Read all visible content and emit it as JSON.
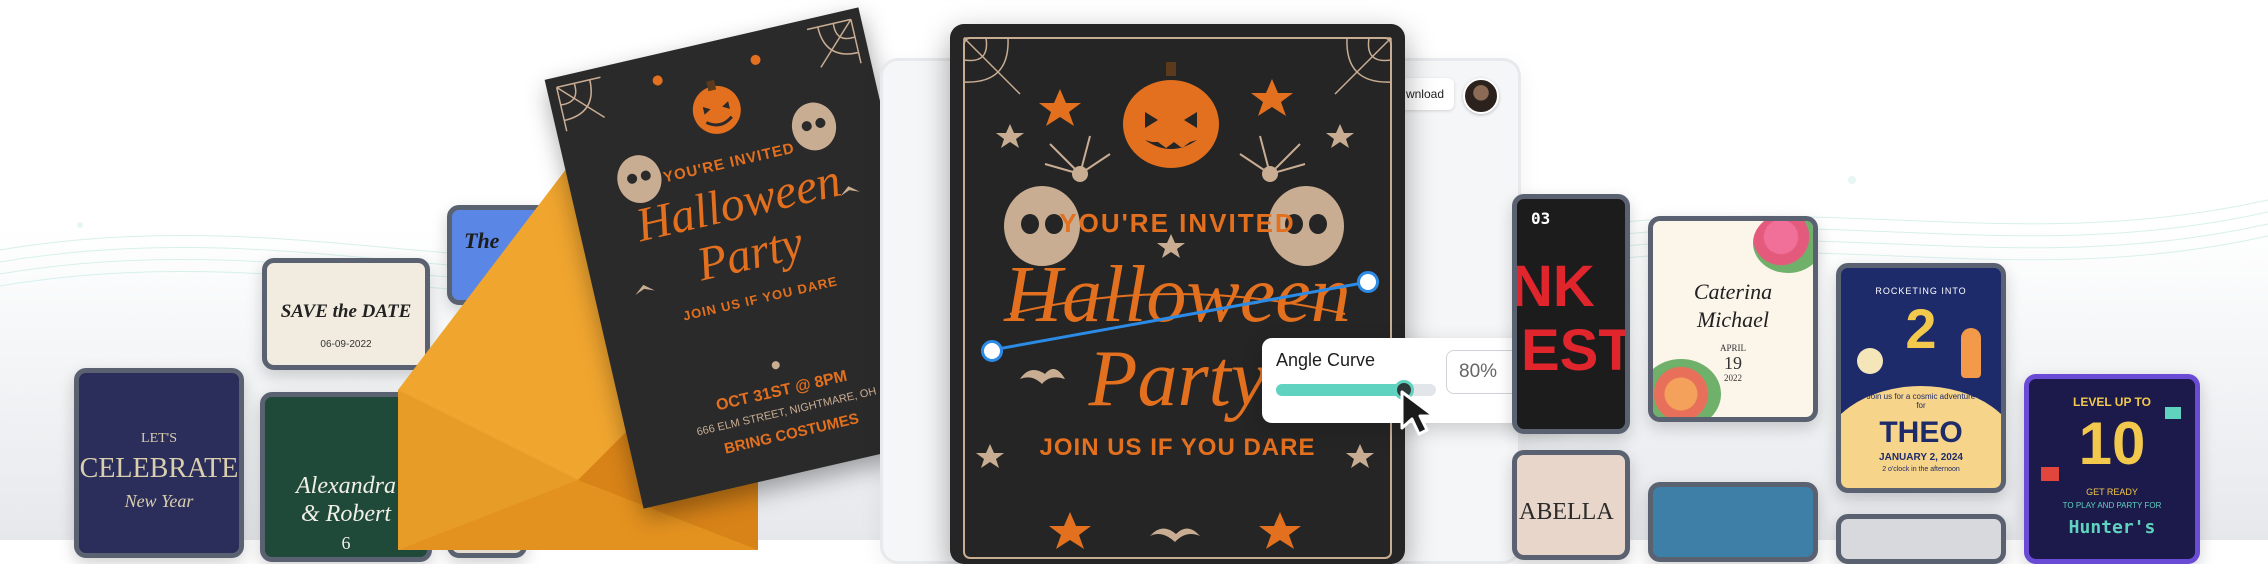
{
  "toolbar": {
    "download_label": "wnload"
  },
  "angle_curve": {
    "label": "Angle Curve",
    "value": "80%",
    "level_percent": 80
  },
  "main_invite": {
    "line1": "YOU'RE INVITED",
    "title1": "Halloween",
    "title2": "Party",
    "line2": "JOIN US IF YOU DARE"
  },
  "tilted_invite": {
    "line1": "YOU'RE INVITED",
    "title1": "Halloween",
    "title2": "Party",
    "line2": "JOIN US IF YOU DARE",
    "date": "OCT 31ST @ 8PM",
    "address": "666 ELM STREET, NIGHTMARE, OH",
    "note": "BRING COSTUMES"
  },
  "cards": {
    "save_date": {
      "title": "SAVE the DATE",
      "date": "06-09-2022"
    },
    "celebrate": {
      "lets": "LET'S",
      "title": "CELEBRATE",
      "sub": "New Year"
    },
    "wedding": {
      "names1": "Alexandra",
      "names2": "& Robert",
      "day": "6"
    },
    "blue_partial": {
      "text": "The"
    },
    "punk": {
      "issue": "03",
      "big1": "NK",
      "big2": "EST"
    },
    "floral": {
      "name1": "Caterina",
      "name2": "Michael",
      "month": "APRIL",
      "day": "19",
      "year": "2022"
    },
    "birthday": {
      "kicker": "ROCKETING INTO",
      "num": "2",
      "cta": "Join us for a cosmic adventure for",
      "name": "THEO",
      "date": "JANUARY 2, 2024",
      "time": "2 o'clock in the afternoon"
    },
    "level": {
      "head": "LEVEL UP TO",
      "num": "10",
      "sub1": "GET READY",
      "sub2": "TO PLAY AND PARTY FOR",
      "name": "Hunter's"
    },
    "bella": {
      "text": "ABELLA"
    }
  },
  "colors": {
    "accent_teal": "#5fd3bf",
    "orange": "#e3701f",
    "tan": "#c9ad93",
    "dark": "#252525",
    "selection_blue": "#2b8be6"
  }
}
